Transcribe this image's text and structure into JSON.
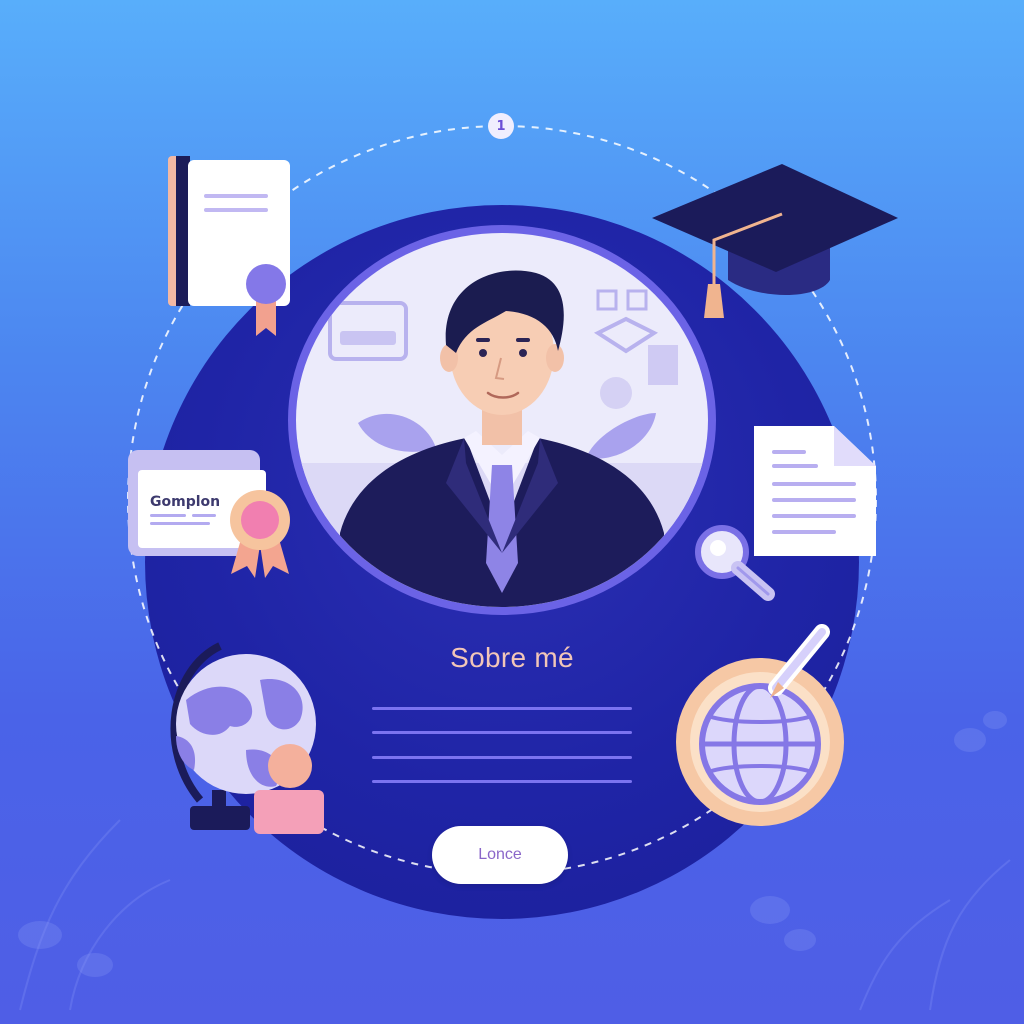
{
  "profile": {
    "section_title": "Sobre mé",
    "cta_label": "Lonce"
  },
  "step_badge": "1",
  "certificate_card": {
    "label": "Gomplon"
  },
  "icons": [
    "certificate-book-icon",
    "graduation-cap-icon",
    "certificate-card-icon",
    "document-icon",
    "magnifier-icon",
    "globe-with-person-icon",
    "globe-with-pen-icon"
  ],
  "colors": {
    "background_top": "#58aefb",
    "background_bottom": "#4f5ee6",
    "main_circle": "#1f24a6",
    "accent_purple": "#7b73f0",
    "title_color": "#f2c6b8",
    "button_text": "#8a66c9"
  }
}
